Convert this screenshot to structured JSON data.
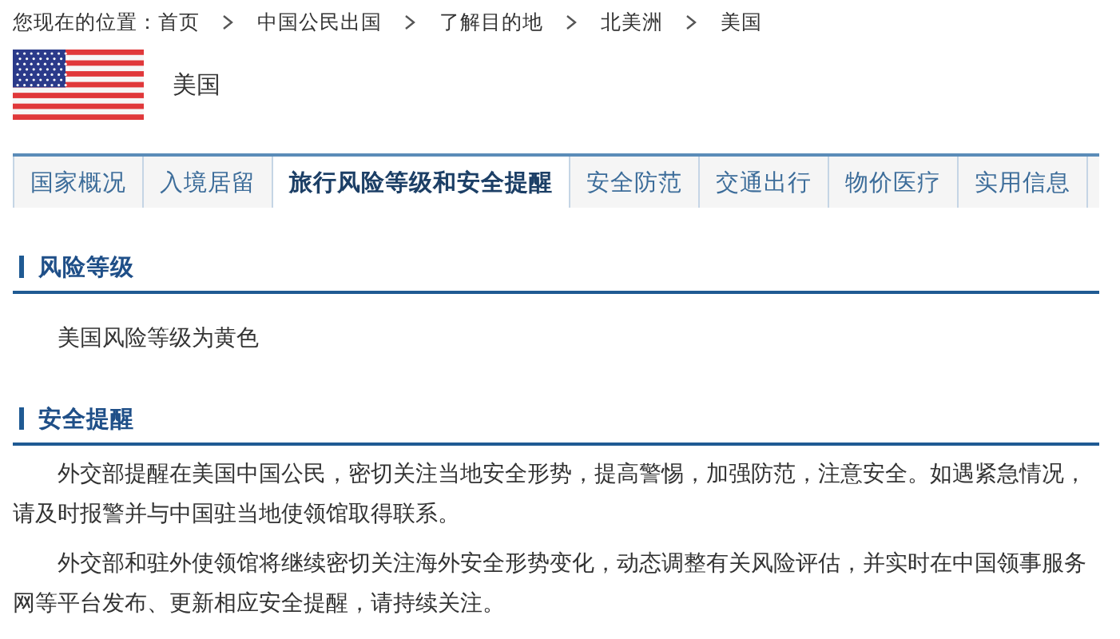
{
  "breadcrumb": {
    "label": "您现在的位置：",
    "items": [
      "首页",
      "中国公民出国",
      "了解目的地",
      "北美洲",
      "美国"
    ]
  },
  "country": {
    "name": "美国"
  },
  "tabs": [
    {
      "label": "国家概况",
      "selected": false
    },
    {
      "label": "入境居留",
      "selected": false
    },
    {
      "label": "旅行风险等级和安全提醒",
      "selected": true
    },
    {
      "label": "安全防范",
      "selected": false
    },
    {
      "label": "交通出行",
      "selected": false
    },
    {
      "label": "物价医疗",
      "selected": false
    },
    {
      "label": "实用信息",
      "selected": false
    }
  ],
  "sections": [
    {
      "title": "风险等级",
      "paragraphs": [
        "美国风险等级为黄色"
      ]
    },
    {
      "title": "安全提醒",
      "paragraphs": [
        "外交部提醒在美国中国公民，密切关注当地安全形势，提高警惕，加强防范，注意安全。如遇紧急情况，请及时报警并与中国驻当地使领馆取得联系。",
        "外交部和驻外使领馆将继续密切关注海外安全形势变化，动态调整有关风险评估，并实时在中国领事服务网等平台发布、更新相应安全提醒，请持续关注。"
      ]
    }
  ]
}
